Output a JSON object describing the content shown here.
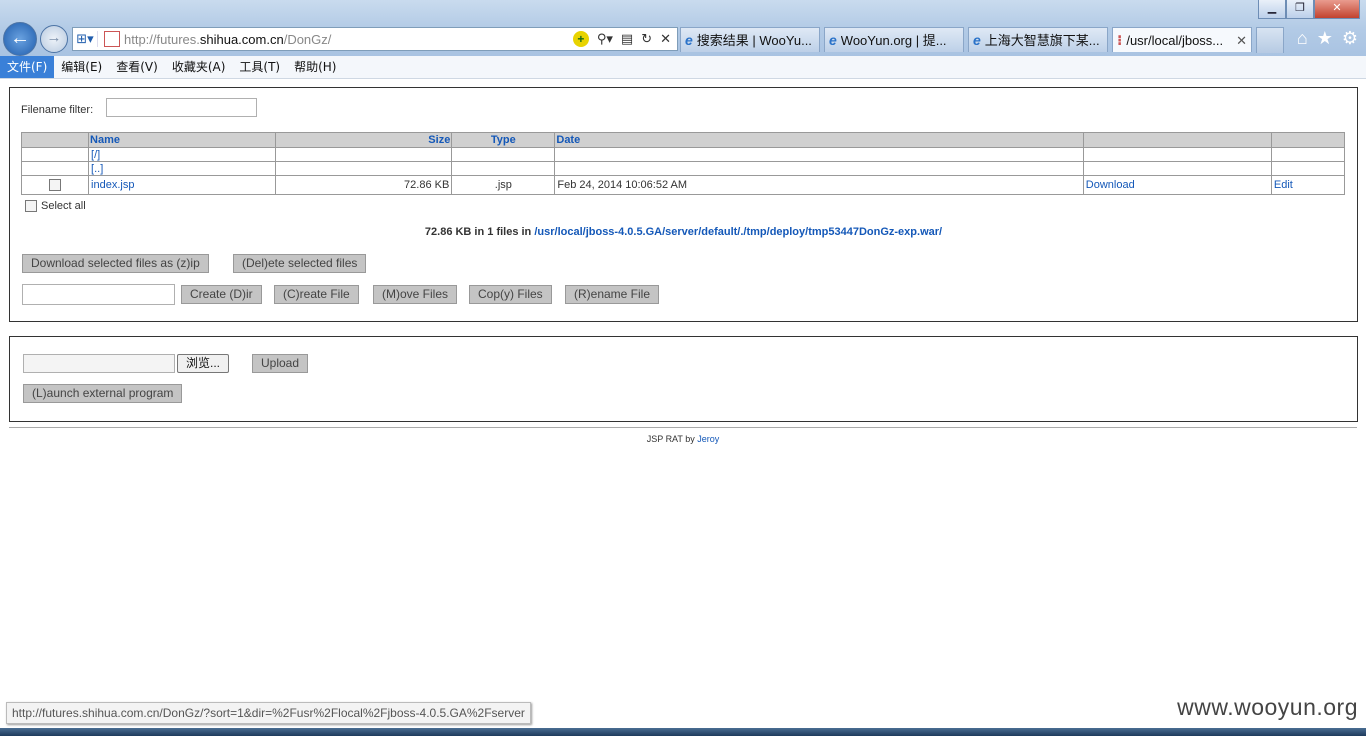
{
  "window": {
    "minimize": "▁",
    "maximize": "❐",
    "close": "✕"
  },
  "address": {
    "url_prefix": "http://futures.",
    "url_domain": "shihua.com.cn",
    "url_suffix": "/DonGz/"
  },
  "tabs": [
    {
      "label": "搜索结果 | WooYu...",
      "active": false
    },
    {
      "label": "WooYun.org | 提...",
      "active": false
    },
    {
      "label": "上海大智慧旗下某...",
      "active": false
    },
    {
      "label": "/usr/local/jboss...",
      "active": true
    }
  ],
  "menu": [
    "文件(F)",
    "编辑(E)",
    "查看(V)",
    "收藏夹(A)",
    "工具(T)",
    "帮助(H)"
  ],
  "filter": {
    "label": "Filename filter:"
  },
  "table": {
    "headers": {
      "name": "Name",
      "size": "Size",
      "type": "Type",
      "date": "Date"
    },
    "rows": [
      {
        "name": "[/]"
      },
      {
        "name": "[..]"
      },
      {
        "name": "index.jsp",
        "size": "72.86 KB",
        "type": ".jsp",
        "date": "Feb 24, 2014 10:06:52 AM",
        "download": "Download",
        "edit": "Edit"
      }
    ]
  },
  "select_all": "Select all",
  "summary": {
    "text": "72.86 KB in 1 files in ",
    "path": "/usr/local/jboss-4.0.5.GA/server/default/./tmp/deploy/tmp53447DonGz-exp.war/"
  },
  "buttons": {
    "download_zip": "Download selected files as (z)ip",
    "delete": "(Del)ete selected files",
    "create_dir": "Create (D)ir",
    "create_file": "(C)reate File",
    "move": "(M)ove Files",
    "copy": "Cop(y) Files",
    "rename": "(R)ename File",
    "browse": "浏览...",
    "upload": "Upload",
    "launch": "(L)aunch external program"
  },
  "footer": {
    "text": "JSP RAT by ",
    "author": "Jeroy"
  },
  "status_url": "http://futures.shihua.com.cn/DonGz/?sort=1&dir=%2Fusr%2Flocal%2Fjboss-4.0.5.GA%2Fserver",
  "watermark": "www.wooyun.org"
}
